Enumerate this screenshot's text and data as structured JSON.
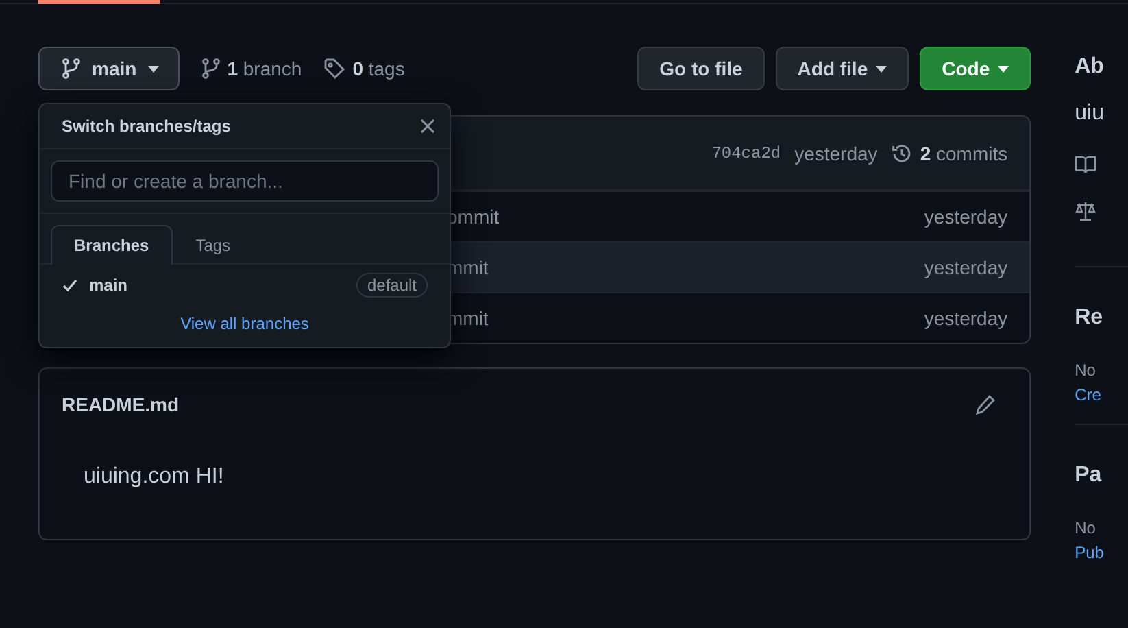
{
  "toolbar": {
    "branch_button": "main",
    "branch_count": "1",
    "branch_label": "branch",
    "tag_count": "0",
    "tag_label": "tags",
    "buttons": [
      {
        "label": "Go to file",
        "kind": "plain",
        "caret": false
      },
      {
        "label": "Add file",
        "kind": "plain",
        "caret": true
      },
      {
        "label": "Code",
        "kind": "primary",
        "caret": true
      }
    ]
  },
  "file_table": {
    "header": {
      "sha": "704ca2d",
      "time": "yesterday",
      "commit_count": "2",
      "commit_label": "commits"
    },
    "rows": [
      {
        "message": "ommit",
        "time": "yesterday",
        "hovered": false
      },
      {
        "message": "mmit",
        "time": "yesterday",
        "hovered": true
      },
      {
        "message": "mmit",
        "time": "yesterday",
        "hovered": false
      }
    ]
  },
  "readme": {
    "title": "README.md",
    "body": "uiuing.com HI!"
  },
  "branch_menu": {
    "title": "Switch branches/tags",
    "search": {
      "placeholder": "Find or create a branch..."
    },
    "tabs": [
      {
        "label": "Branches",
        "selected": true
      },
      {
        "label": "Tags",
        "selected": false
      }
    ],
    "branches": [
      {
        "name": "main",
        "checked": true,
        "badge": "default"
      }
    ],
    "link": "View all branches"
  },
  "sidebar": [
    {
      "kind": "heading",
      "text": "Ab"
    },
    {
      "kind": "text",
      "text": "uiu"
    },
    {
      "kind": "book"
    },
    {
      "kind": "scale"
    },
    {
      "kind": "divider"
    },
    {
      "kind": "heading",
      "text": "Re"
    },
    {
      "kind": "small",
      "text": "No"
    },
    {
      "kind": "link",
      "text": "Cre"
    },
    {
      "kind": "divider"
    },
    {
      "kind": "heading",
      "text": "Pa"
    },
    {
      "kind": "small",
      "text": "No"
    },
    {
      "kind": "link",
      "text": "Pub"
    }
  ]
}
